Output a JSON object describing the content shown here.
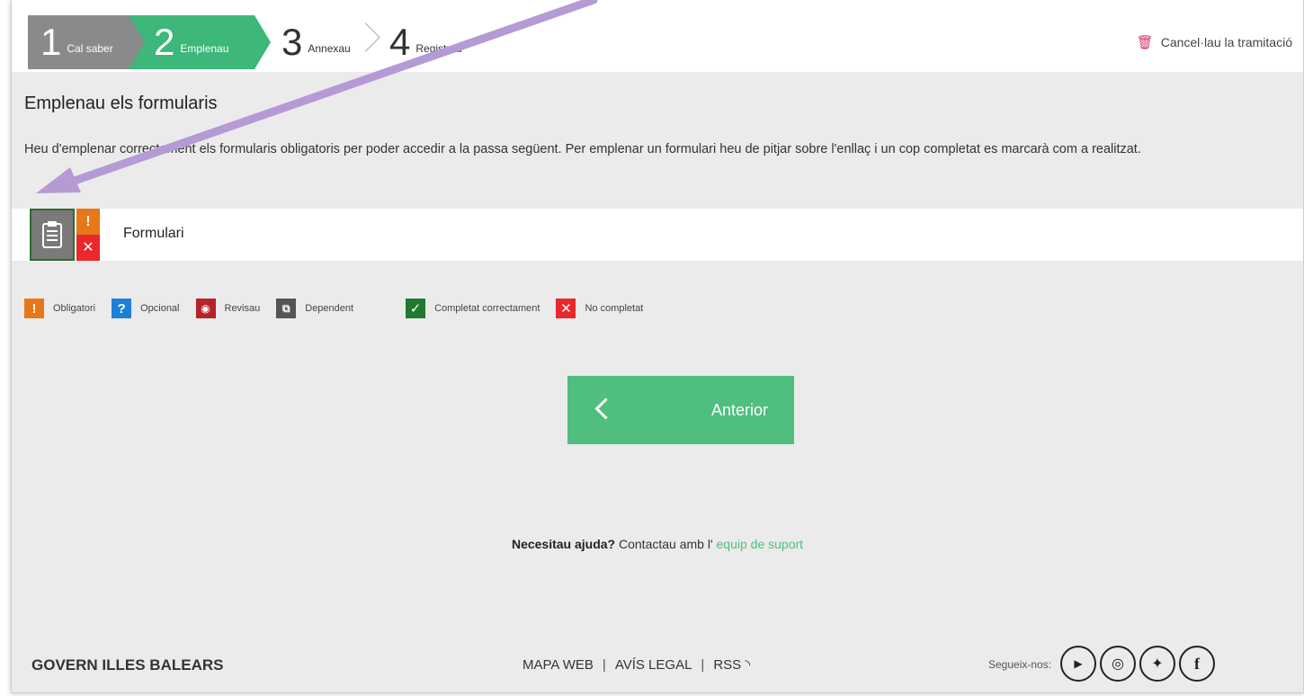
{
  "steps": [
    {
      "num": "1",
      "label": "Cal saber"
    },
    {
      "num": "2",
      "label": "Emplenau"
    },
    {
      "num": "3",
      "label": "Annexau"
    },
    {
      "num": "4",
      "label": "Registrau"
    }
  ],
  "header": {
    "cancel_label": "Cancel·lau la tramitació"
  },
  "main": {
    "title": "Emplenau els formularis",
    "description": "Heu d'emplenar correctament els formularis obligatoris per poder accedir a la passa següent. Per emplenar un formulari heu de pitjar sobre l'enllaç i un cop completat es marcarà com a realitzat.",
    "form_name": "Formulari"
  },
  "legend": {
    "obligatori": "Obligatori",
    "opcional": "Opcional",
    "revisau": "Revisau",
    "dependent": "Dependent",
    "completat": "Completat correctament",
    "no_completat": "No completat"
  },
  "button": {
    "previous_label": "Anterior"
  },
  "help": {
    "question": "Necesitau ajuda?",
    "text": " Contactau amb l' ",
    "link": "equip de suport"
  },
  "footer": {
    "brand": "GOVERN ILLES BALEARS",
    "mapa": "MAPA WEB",
    "avis": "AVÍS LEGAL",
    "rss": "RSS",
    "follow": "Segueix-nos:"
  },
  "colors": {
    "step_done": "#8a8a8a",
    "step_active": "#3db77a",
    "button": "#4fbe7e",
    "obligatori": "#e67817",
    "opcional": "#1e7fd6",
    "revisau": "#b5232b",
    "dependent": "#555555",
    "completat": "#1f7a2f",
    "no_completat": "#e8282b",
    "annotation": "#b59ad6"
  }
}
